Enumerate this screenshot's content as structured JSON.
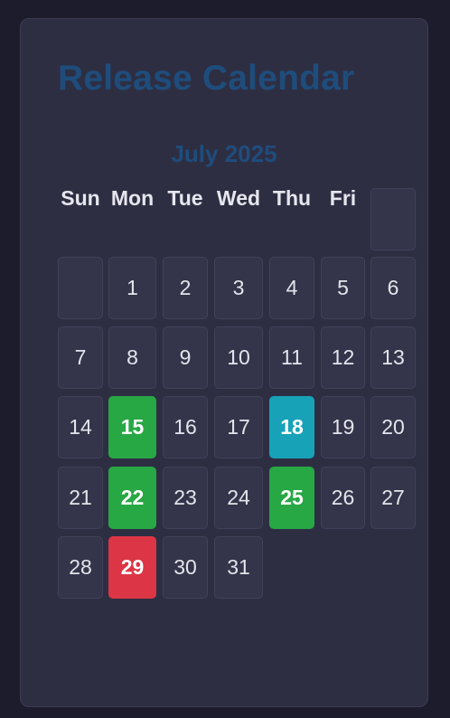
{
  "title": "Release Calendar",
  "month_label": "July 2025",
  "weekdays": [
    "Sun",
    "Mon",
    "Tue",
    "Wed",
    "Thu",
    "Fri"
  ],
  "days": [
    "1",
    "2",
    "3",
    "4",
    "5",
    "6",
    "7",
    "8",
    "9",
    "10",
    "11",
    "12",
    "13",
    "14",
    "15",
    "16",
    "17",
    "18",
    "19",
    "20",
    "21",
    "22",
    "23",
    "24",
    "25",
    "26",
    "27",
    "28",
    "29",
    "30",
    "31"
  ],
  "highlights": {
    "15": "#28a745",
    "18": "#17a2b8",
    "22": "#28a745",
    "25": "#28a745",
    "29": "#dc3545"
  }
}
